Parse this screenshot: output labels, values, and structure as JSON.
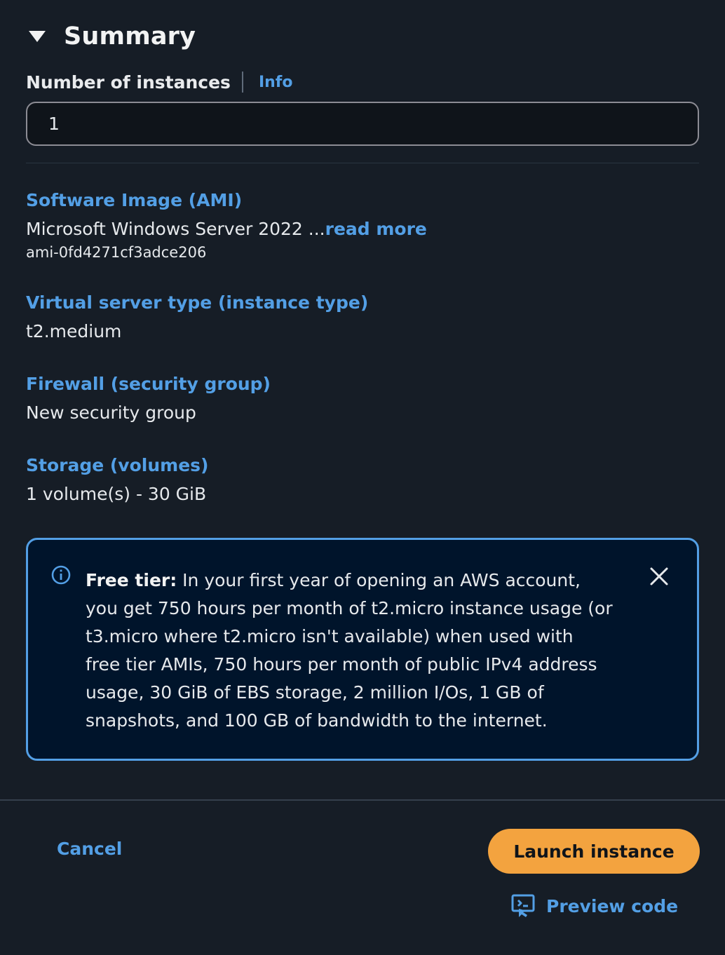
{
  "summary": {
    "title": "Summary"
  },
  "instances": {
    "label": "Number of instances",
    "info_label": "Info",
    "value": "1"
  },
  "sections": {
    "ami": {
      "title": "Software Image (AMI)",
      "value": "Microsoft Windows Server 2022 ...",
      "read_more": "read more",
      "id": "ami-0fd4271cf3adce206"
    },
    "instance_type": {
      "title": "Virtual server type (instance type)",
      "value": "t2.medium"
    },
    "firewall": {
      "title": "Firewall (security group)",
      "value": "New security group"
    },
    "storage": {
      "title": "Storage (volumes)",
      "value": "1 volume(s) - 30 GiB"
    }
  },
  "alert": {
    "heading": "Free tier:",
    "body": " In your first year of opening an AWS account, you get 750 hours per month of t2.micro instance usage (or t3.micro where t2.micro isn't available) when used with free tier AMIs, 750 hours per month of public IPv4 address usage, 30 GiB of EBS storage, 2 million I/Os, 1 GB of snapshots, and 100 GB of bandwidth to the internet."
  },
  "footer": {
    "cancel_label": "Cancel",
    "launch_label": "Launch instance",
    "preview_label": "Preview code"
  },
  "colors": {
    "background": "#161d26",
    "link": "#539fe5",
    "primary_button": "#f3a33f",
    "alert_background": "#00142b"
  }
}
